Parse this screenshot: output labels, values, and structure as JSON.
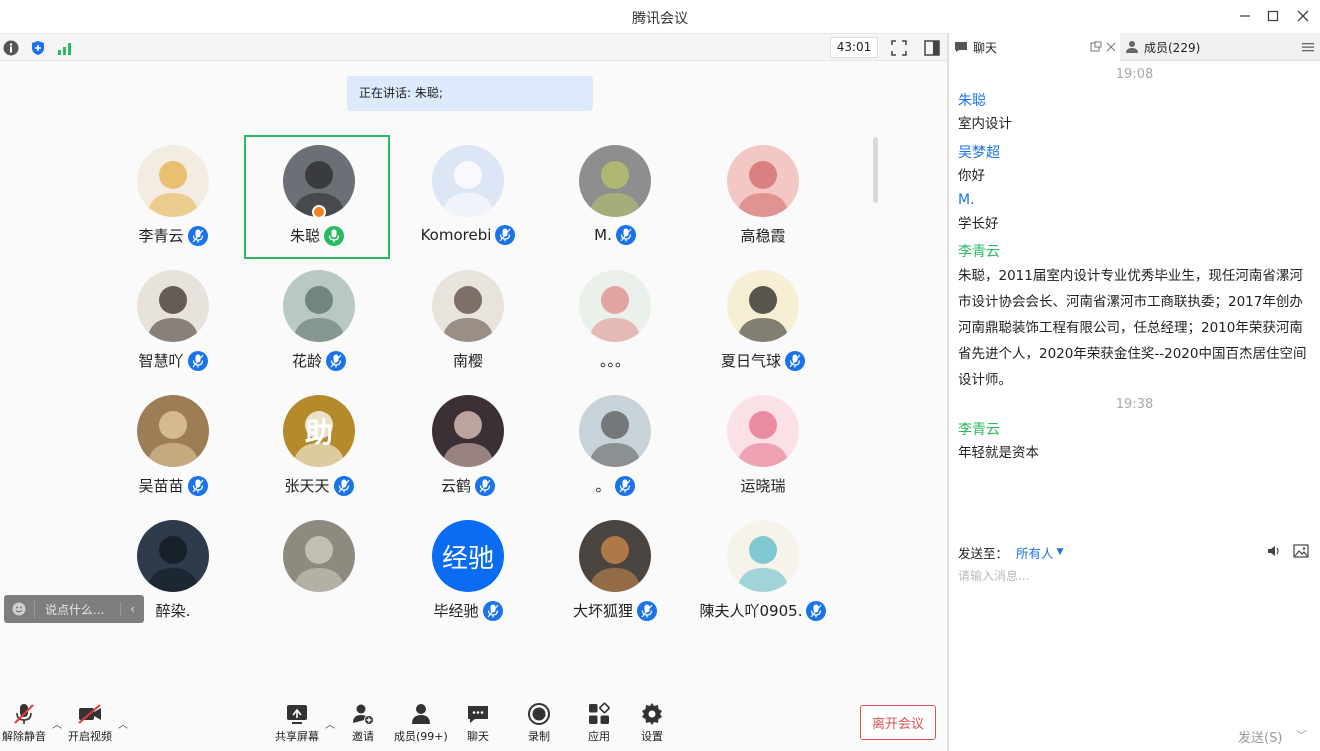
{
  "window": {
    "title": "腾讯会议"
  },
  "toolbar": {
    "timer": "43:01"
  },
  "speaking": {
    "text": "正在讲话: 朱聪;"
  },
  "participants": [
    {
      "name": "李青云",
      "mic": "muted",
      "avatar_color": "#f3ece2",
      "accent": "#e6b04a"
    },
    {
      "name": "朱聪",
      "mic": "on",
      "active": true,
      "host": true,
      "avatar_color": "#6b6f76",
      "accent": "#2a2a2a"
    },
    {
      "name": "Komorebi",
      "mic": "muted",
      "avatar_color": "#dde6f4",
      "accent": "#ffffff"
    },
    {
      "name": "M.",
      "mic": "muted",
      "avatar_color": "#8e8e8e",
      "accent": "#b9c46a"
    },
    {
      "name": "高稳霞",
      "mic": "none",
      "avatar_color": "#f3c7c3",
      "accent": "#d06a6a"
    },
    {
      "name": "智慧吖",
      "mic": "muted",
      "avatar_color": "#e8e2dc",
      "accent": "#3a2f2a"
    },
    {
      "name": "花龄",
      "mic": "muted",
      "avatar_color": "#b8c9c4",
      "accent": "#5b6d6a"
    },
    {
      "name": "南樱",
      "mic": "none",
      "avatar_color": "#e9e3de",
      "accent": "#5a4a40"
    },
    {
      "name": "。。。",
      "mic": "none",
      "avatar_color": "#eaf1ea",
      "accent": "#e08b8b"
    },
    {
      "name": "夏日气球",
      "mic": "muted",
      "avatar_color": "#f7efd3",
      "accent": "#222222"
    },
    {
      "name": "吴苗苗",
      "mic": "muted",
      "avatar_color": "#9c7d55",
      "accent": "#e9cfa3"
    },
    {
      "name": "张天天",
      "mic": "muted",
      "avatar_color": "#b58a2a",
      "accent": "#ffffff",
      "glyph": "助"
    },
    {
      "name": "云鹤",
      "mic": "muted",
      "avatar_color": "#3b3035",
      "accent": "#e8c9c0"
    },
    {
      "name": "。",
      "mic": "muted",
      "avatar_color": "#c7d3d9",
      "accent": "#5a5a5a"
    },
    {
      "name": "运晓瑞",
      "mic": "none",
      "avatar_color": "#fbe0e6",
      "accent": "#e56f8b"
    },
    {
      "name": "醉染.",
      "mic": "none",
      "avatar_color": "#2e3b4a",
      "accent": "#111820"
    },
    {
      "name": "",
      "mic": "none",
      "avatar_color": "#8d8b80",
      "accent": "#d4d0c2"
    },
    {
      "name": "毕经驰",
      "mic": "muted",
      "text_avatar": "经驰"
    },
    {
      "name": "大坏狐狸",
      "mic": "muted",
      "avatar_color": "#4a4540",
      "accent": "#d08a4a"
    },
    {
      "name": "陳夫人吖0905.",
      "mic": "muted",
      "avatar_color": "#f6f3ea",
      "accent": "#5ab9c8"
    }
  ],
  "overlay_input": {
    "hint": "说点什么..."
  },
  "bottom": {
    "unmute": "解除静音",
    "video": "开启视频",
    "share": "共享屏幕",
    "invite": "邀请",
    "members": "成员(99+)",
    "chat": "聊天",
    "record": "录制",
    "apps": "应用",
    "settings": "设置",
    "leave": "离开会议"
  },
  "right_panel": {
    "tab_chat": "聊天",
    "tab_members": "成员(229)",
    "time1": "19:08",
    "messages": [
      {
        "sender": "朱聪",
        "color": "#1a73e8",
        "text": "室内设计"
      },
      {
        "sender": "吴梦超",
        "color": "#1a73e8",
        "text": "你好"
      },
      {
        "sender": "M.",
        "color": "#1a73e8",
        "text": "学长好"
      },
      {
        "sender": "李青云",
        "color": "#2cb964",
        "text": "朱聪，2011届室内设计专业优秀毕业生，现任河南省漯河市设计协会会长、河南省漯河市工商联执委；2017年创办河南鼎聪装饰工程有限公司，任总经理；2010年荣获河南省先进个人，2020年荣获金住奖--2020中国百杰居住空间设计师。"
      }
    ],
    "time2": "19:38",
    "messages2": [
      {
        "sender": "李青云",
        "color": "#2cb964",
        "text": "年轻就是资本"
      }
    ],
    "send_to": "发送至：",
    "recipient": "所有人",
    "placeholder": "请输入消息...",
    "send": "发送(S)"
  }
}
